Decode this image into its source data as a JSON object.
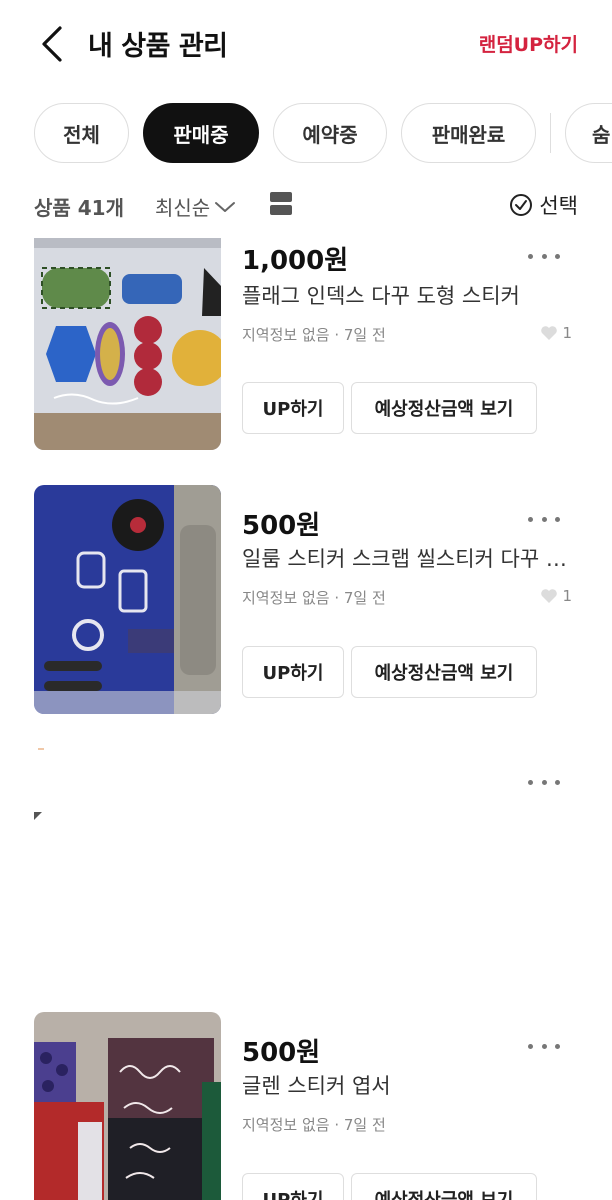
{
  "header": {
    "title": "내 상품 관리",
    "random_up": "랜덤UP하기"
  },
  "filters": {
    "chips": [
      "전체",
      "판매중",
      "예약중",
      "판매완료",
      "숨"
    ],
    "active": "판매중"
  },
  "sortbar": {
    "count": "상품 41개",
    "sort": "최신순",
    "select": "선택"
  },
  "products": [
    {
      "price": "1,000원",
      "name": "플래그 인덱스 다꾸 도형 스티커",
      "meta": "지역정보 없음 · 7일 전",
      "likes": "1",
      "up_label": "UP하기",
      "settle_label": "예상정산금액 보기"
    },
    {
      "price": "500원",
      "name": "일룸 스티커 스크랩 씰스티커 다꾸 스티커",
      "meta": "지역정보 없음 · 7일 전",
      "likes": "1",
      "up_label": "UP하기",
      "settle_label": "예상정산금액 보기"
    },
    {
      "price": "500원",
      "name": "글렌 스티커 엽서",
      "meta": "지역정보 없음 · 7일 전",
      "up_label": "UP하기",
      "settle_label": "예상정산금액 보기"
    }
  ],
  "colors": {
    "accent": "#d4233f",
    "chip_active_bg": "#111111",
    "border": "#dedede"
  }
}
